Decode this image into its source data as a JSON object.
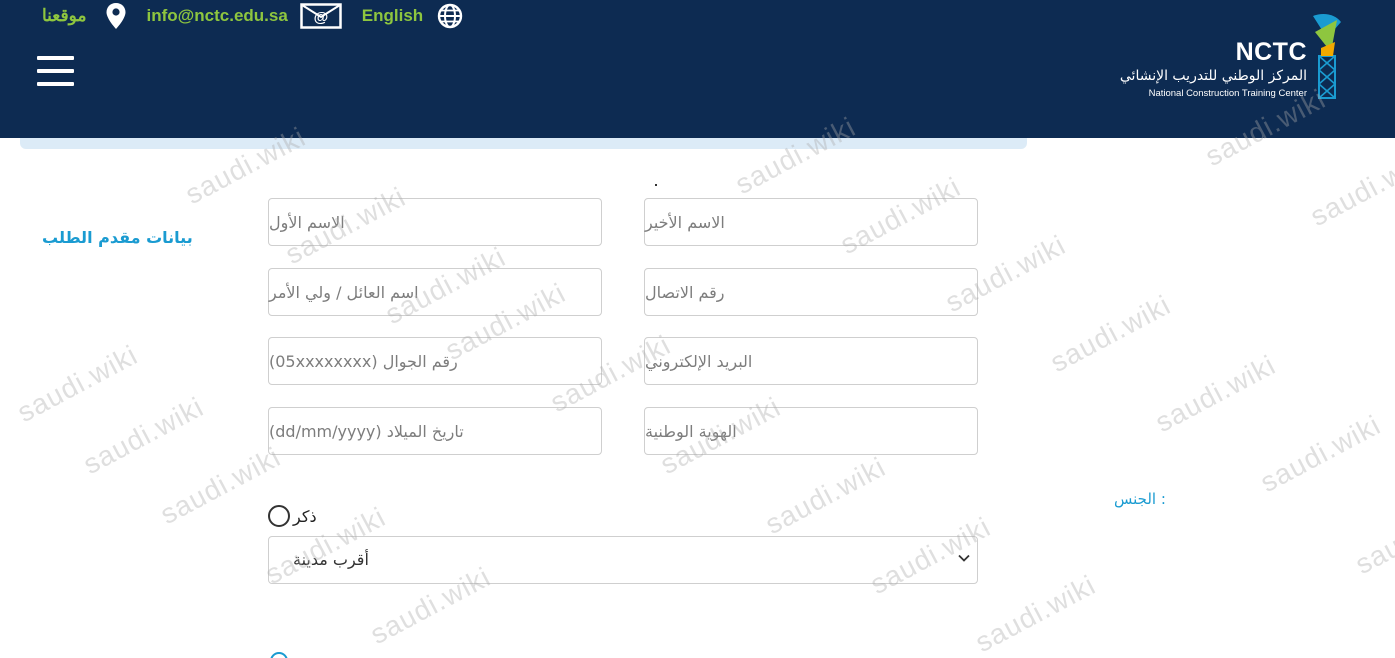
{
  "topbar": {
    "location_label": "موقعنا",
    "email": "info@nctc.edu.sa",
    "language_label": "English"
  },
  "logo": {
    "abbr": "NCTC",
    "name_ar": "المركز الوطني للتدريب الإنشائي",
    "name_en": "National Construction Training Center"
  },
  "form": {
    "section_title": "بيانات مقدم الطلب",
    "fields": {
      "last_name": "الاسم الأخير",
      "first_name": "الاسم الأول",
      "phone": "رقم الاتصال",
      "guardian": "اسم العائل / ولي الأمر",
      "email": "البريد الإلكتروني",
      "mobile": "رقم الجوال (05xxxxxxxx)",
      "national_id": "الهوية الوطنية",
      "birthdate": "تاريخ الميلاد  (dd/mm/yyyy)"
    },
    "gender_label": ": الجنس",
    "gender_option_male": "ذكر",
    "nearest_city": "أقرب مدينة"
  },
  "watermark_text": "saudi.wiki",
  "colors": {
    "header_bg": "#0d2b52",
    "accent_green": "#8ec63f",
    "accent_blue": "#1a9bd1"
  }
}
